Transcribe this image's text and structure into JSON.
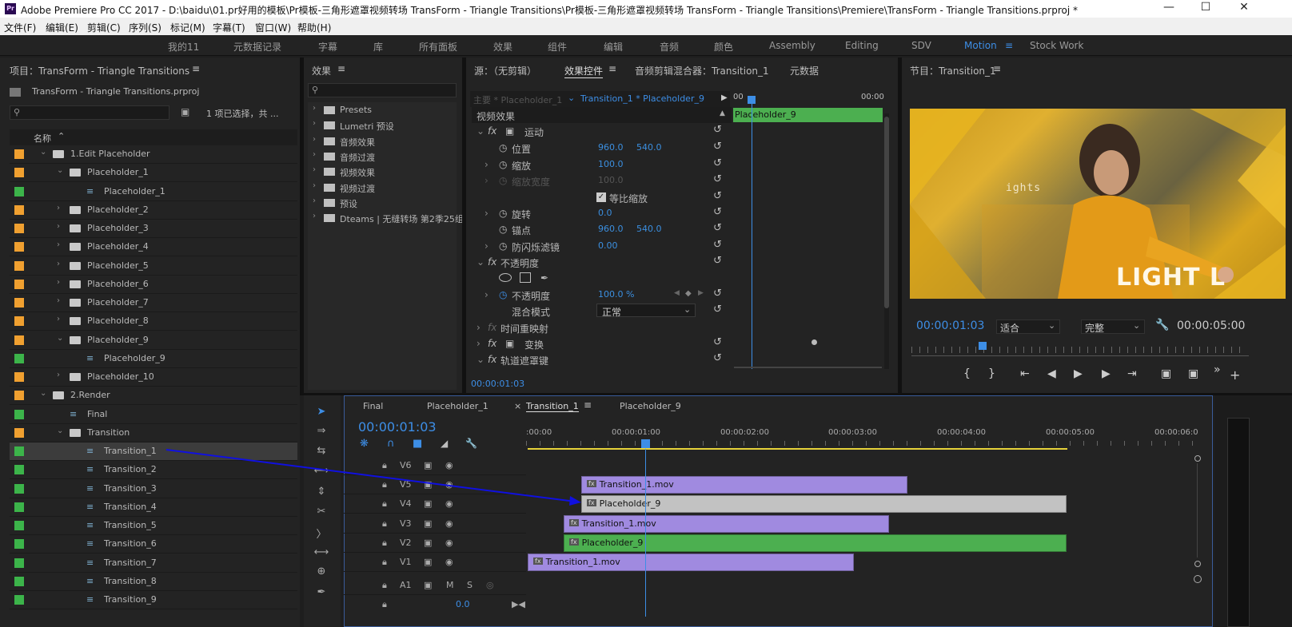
{
  "titlebar": {
    "icon": "Pr",
    "title": "Adobe Premiere Pro CC 2017 - D:\\baidu\\01.pr好用的模板\\Pr模板-三角形遮罩视频转场 TransForm - Triangle Transitions\\Pr模板-三角形遮罩视频转场 TransForm - Triangle Transitions\\Premiere\\TransForm - Triangle Transitions.prproj *"
  },
  "menu": [
    "文件(F)",
    "编辑(E)",
    "剪辑(C)",
    "序列(S)",
    "标记(M)",
    "字幕(T)",
    "窗口(W)",
    "帮助(H)"
  ],
  "workspaces": [
    "我的11",
    "元数据记录",
    "字幕",
    "库",
    "所有面板",
    "效果",
    "组件",
    "编辑",
    "音频",
    "颜色",
    "Assembly",
    "Editing",
    "SDV",
    "Motion",
    "Stock Work"
  ],
  "workspace_active": "Motion",
  "project": {
    "title": "项目：TransForm - Triangle Transitions",
    "file": "TransForm - Triangle Transitions.prproj",
    "selection_info": "1 项已选择，共 ...",
    "column": "名称",
    "items": [
      {
        "label": "1.Edit Placeholder",
        "kind": "folder",
        "color": "#f0a030",
        "indent": 0,
        "open": true
      },
      {
        "label": "Placeholder_1",
        "kind": "folder",
        "color": "#f0a030",
        "indent": 1,
        "open": true
      },
      {
        "label": "Placeholder_1",
        "kind": "seq",
        "color": "#3cb44a",
        "indent": 2
      },
      {
        "label": "Placeholder_2",
        "kind": "folder",
        "color": "#f0a030",
        "indent": 1
      },
      {
        "label": "Placeholder_3",
        "kind": "folder",
        "color": "#f0a030",
        "indent": 1
      },
      {
        "label": "Placeholder_4",
        "kind": "folder",
        "color": "#f0a030",
        "indent": 1
      },
      {
        "label": "Placeholder_5",
        "kind": "folder",
        "color": "#f0a030",
        "indent": 1
      },
      {
        "label": "Placeholder_6",
        "kind": "folder",
        "color": "#f0a030",
        "indent": 1
      },
      {
        "label": "Placeholder_7",
        "kind": "folder",
        "color": "#f0a030",
        "indent": 1
      },
      {
        "label": "Placeholder_8",
        "kind": "folder",
        "color": "#f0a030",
        "indent": 1
      },
      {
        "label": "Placeholder_9",
        "kind": "folder",
        "color": "#f0a030",
        "indent": 1,
        "open": true
      },
      {
        "label": "Placeholder_9",
        "kind": "seq",
        "color": "#3cb44a",
        "indent": 2
      },
      {
        "label": "Placeholder_10",
        "kind": "folder",
        "color": "#f0a030",
        "indent": 1
      },
      {
        "label": "2.Render",
        "kind": "folder",
        "color": "#f0a030",
        "indent": 0,
        "open": true
      },
      {
        "label": "Final",
        "kind": "seq",
        "color": "#3cb44a",
        "indent": 1
      },
      {
        "label": "Transition",
        "kind": "folder",
        "color": "#f0a030",
        "indent": 1,
        "open": true
      },
      {
        "label": "Transition_1",
        "kind": "seq",
        "color": "#3cb44a",
        "indent": 2,
        "selected": true
      },
      {
        "label": "Transition_2",
        "kind": "seq",
        "color": "#3cb44a",
        "indent": 2
      },
      {
        "label": "Transition_3",
        "kind": "seq",
        "color": "#3cb44a",
        "indent": 2
      },
      {
        "label": "Transition_4",
        "kind": "seq",
        "color": "#3cb44a",
        "indent": 2
      },
      {
        "label": "Transition_5",
        "kind": "seq",
        "color": "#3cb44a",
        "indent": 2
      },
      {
        "label": "Transition_6",
        "kind": "seq",
        "color": "#3cb44a",
        "indent": 2
      },
      {
        "label": "Transition_7",
        "kind": "seq",
        "color": "#3cb44a",
        "indent": 2
      },
      {
        "label": "Transition_8",
        "kind": "seq",
        "color": "#3cb44a",
        "indent": 2
      },
      {
        "label": "Transition_9",
        "kind": "seq",
        "color": "#3cb44a",
        "indent": 2
      }
    ]
  },
  "effects": {
    "title": "效果",
    "items": [
      "Presets",
      "Lumetri 预设",
      "音频效果",
      "音频过渡",
      "视频效果",
      "视频过渡",
      "预设",
      "Dteams | 无缝转场 第2季25组"
    ]
  },
  "effect_controls": {
    "tabs": [
      "源：（无剪辑）",
      "效果控件",
      "音频剪辑混合器：Transition_1",
      "元数据"
    ],
    "master": "主要 * Placeholder_1",
    "clip": "Transition_1 * Placeholder_9",
    "section": "视频效果",
    "motion": "运动",
    "position": {
      "label": "位置",
      "x": "960.0",
      "y": "540.0"
    },
    "scale": {
      "label": "缩放",
      "v": "100.0"
    },
    "scale_width": {
      "label": "缩放宽度",
      "v": "100.0"
    },
    "uniform": "等比缩放",
    "rotation": {
      "label": "旋转",
      "v": "0.0"
    },
    "anchor": {
      "label": "锚点",
      "x": "960.0",
      "y": "540.0"
    },
    "flicker": {
      "label": "防闪烁滤镜",
      "v": "0.00"
    },
    "opacity_group": "不透明度",
    "opacity": {
      "label": "不透明度",
      "v": "100.0 %"
    },
    "blend": {
      "label": "混合模式",
      "v": "正常"
    },
    "time_remap": "时间重映射",
    "transform": "变换",
    "track_matte": "轨道遮罩键",
    "mini_clip": "Placeholder_9",
    "mini_t0": "00",
    "mini_t1": "00:00",
    "timecode": "00:00:01:03"
  },
  "program": {
    "title": "节目：Transition_1",
    "overlay_small": "ights",
    "overlay_big": "LIGHT L",
    "timecode": "00:00:01:03",
    "fit": "适合",
    "quality": "完整",
    "duration": "00:00:05:00"
  },
  "timeline": {
    "tabs": [
      "Final",
      "Placeholder_1",
      "Transition_1",
      "Placeholder_9"
    ],
    "active_tab": "Transition_1",
    "timecode": "00:00:01:03",
    "ruler": [
      ":00:00",
      "00:00:01:00",
      "00:00:02:00",
      "00:00:03:00",
      "00:00:04:00",
      "00:00:05:00",
      "00:00:06:0"
    ],
    "tracks": [
      "V6",
      "V5",
      "V4",
      "V3",
      "V2",
      "V1",
      "A1"
    ],
    "a1_m": "M",
    "a1_s": "S",
    "a1_vol": "0.0",
    "clips": [
      {
        "track": "V5",
        "name": "Transition_1.mov",
        "color": "#a08ae0"
      },
      {
        "track": "V4",
        "name": "Placeholder_9",
        "color": "#c2c2c2"
      },
      {
        "track": "V3",
        "name": "Transition_1.mov",
        "color": "#a08ae0"
      },
      {
        "track": "V2",
        "name": "Placeholder_9",
        "color": "#4caf50"
      },
      {
        "track": "V1",
        "name": "Transition_1.mov",
        "color": "#a08ae0"
      }
    ]
  },
  "accent": "#3d8ee6"
}
